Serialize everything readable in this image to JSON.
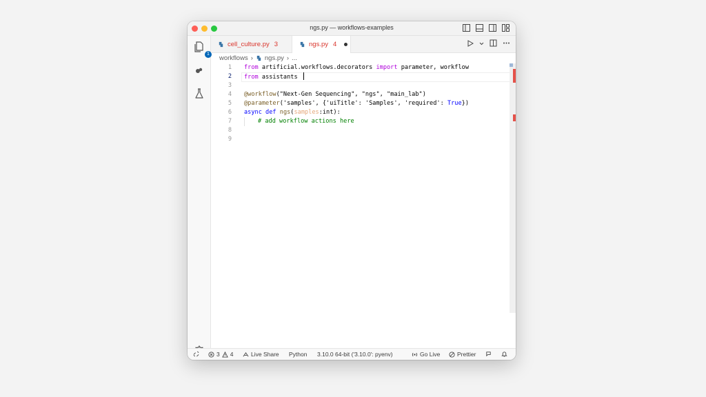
{
  "window": {
    "title": "ngs.py — workflows-examples"
  },
  "activity_bar": {
    "explorer_badge": "1"
  },
  "tabs": [
    {
      "label": "cell_culture.py",
      "problems": "3"
    },
    {
      "label": "ngs.py",
      "problems": "4"
    }
  ],
  "breadcrumb": {
    "folder": "workflows",
    "file": "ngs.py",
    "more": "..."
  },
  "editor": {
    "lines": [
      {
        "num": "1",
        "tokens": [
          [
            "kw",
            "from"
          ],
          [
            "",
            "artificial.workflows.decorators"
          ],
          [
            "kw",
            "import"
          ],
          [
            "",
            "parameter, workflow"
          ]
        ]
      },
      {
        "num": "2",
        "tokens": [
          [
            "kw",
            "from"
          ],
          [
            "",
            "assistants"
          ]
        ]
      },
      {
        "num": "3",
        "tokens": []
      },
      {
        "num": "4",
        "tokens": [
          [
            "dec",
            "@workflow"
          ],
          [
            "",
            "(\"Next-Gen Sequencing\", \"ngs\", \"main_lab\")"
          ]
        ]
      },
      {
        "num": "5",
        "tokens": [
          [
            "dec",
            "@parameter"
          ],
          [
            "",
            "('samples', {'uiTitle': 'Samples', 'required': True})"
          ]
        ]
      },
      {
        "num": "6",
        "tokens": [
          [
            "kw2",
            "async def"
          ],
          [
            "fn",
            "ngs"
          ],
          [
            "",
            "(samples:int):"
          ]
        ]
      },
      {
        "num": "7",
        "tokens": [
          [
            "cmt",
            "# add workflow actions here"
          ]
        ]
      },
      {
        "num": "8",
        "tokens": []
      },
      {
        "num": "9",
        "tokens": []
      }
    ]
  },
  "status_bar": {
    "errors": "3",
    "warnings": "4",
    "live_share": "Live Share",
    "language": "Python",
    "interpreter": "3.10.0 64-bit ('3.10.0': pyenv)",
    "go_live": "Go Live",
    "prettier": "Prettier"
  },
  "colors": {
    "accent": "#0066b8",
    "error": "#d9342b",
    "close": "#fe5f57",
    "minimize": "#febc2e",
    "maximize": "#28c840"
  }
}
